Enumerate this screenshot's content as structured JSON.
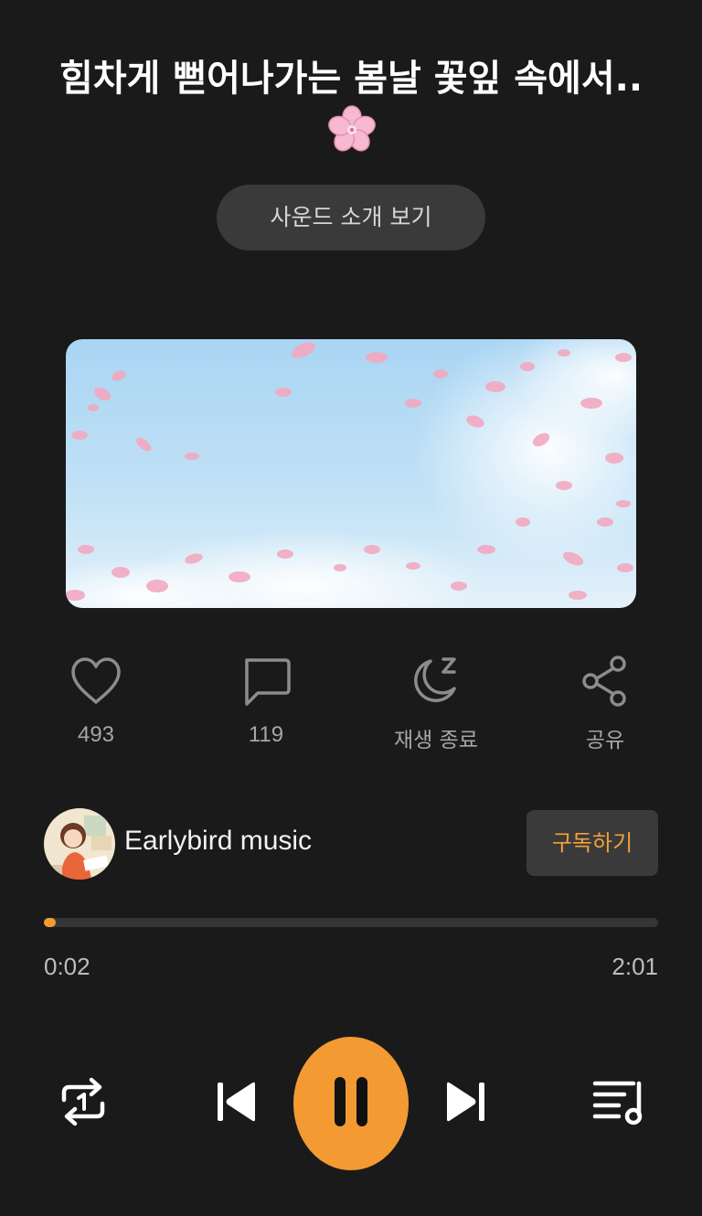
{
  "track": {
    "title": "힘차게 뻗어나가는 봄날 꽃잎 속에서..",
    "title_emoji": "cherry-blossom-emoji"
  },
  "intro_button": {
    "label": "사운드 소개 보기"
  },
  "actions": {
    "like": {
      "icon": "heart-icon",
      "label": "493"
    },
    "comments": {
      "icon": "comment-icon",
      "label": "119"
    },
    "sleep_timer": {
      "icon": "moon-sleep-icon",
      "label": "재생 종료"
    },
    "share": {
      "icon": "share-icon",
      "label": "공유"
    }
  },
  "channel": {
    "name": "Earlybird music",
    "subscribe_label": "구독하기"
  },
  "player": {
    "current_time": "0:02",
    "total_time": "2:01",
    "progress_fraction": 0.0165,
    "state": "playing"
  },
  "colors": {
    "background": "#1a1a1a",
    "accent": "#f39a33",
    "button_bg": "#3a3a3a",
    "muted_text": "#a6a6a6"
  }
}
